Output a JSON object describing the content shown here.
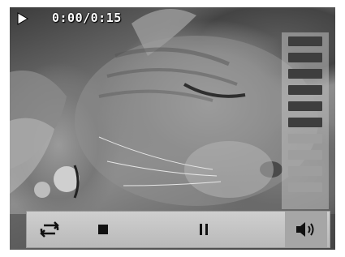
{
  "player": {
    "state_icon": "play-icon",
    "time_readout": "0:00/0:15"
  },
  "volume": {
    "total_bars": 10,
    "active_bars": 6
  },
  "controls": {
    "repeat_icon": "repeat-icon",
    "stop_icon": "stop-icon",
    "pause_icon": "pause-icon",
    "volume_icon": "speaker-icon"
  },
  "colors": {
    "bar_on": "#3e3e3e",
    "bar_off": "#9e9e9e",
    "control_bar": "#c4c4c4"
  }
}
